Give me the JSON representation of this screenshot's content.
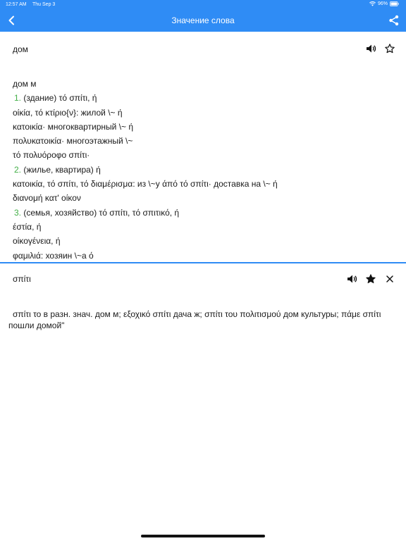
{
  "status_bar": {
    "time": "12:57 AM",
    "date": "Thu Sep 3",
    "battery": "96%"
  },
  "header": {
    "title": "Значение слова",
    "back_icon": "chevron-left-icon",
    "share_icon": "share-icon"
  },
  "colors": {
    "accent": "#2f8cf5",
    "number": "#43b047"
  },
  "panel1": {
    "word": "дом",
    "icons": [
      "speaker-icon",
      "star-outline-icon"
    ],
    "lines": [
      {
        "num": "",
        "text": "дом м"
      },
      {
        "num": "1.",
        "text": " (здание) τό σπίτι, ή"
      },
      {
        "num": "",
        "text": "οίκία, τό κτίριο{ν}: жилой \\~ ή"
      },
      {
        "num": "",
        "text": "κατοικία· многоквартирный \\~ ή"
      },
      {
        "num": "",
        "text": "πολυκατοικία· многоэтажный \\~"
      },
      {
        "num": "",
        "text": "τό πολυόροφο σπίτι·"
      },
      {
        "num": "2.",
        "text": " (жилье, квартира) ή"
      },
      {
        "num": "",
        "text": "κατοικία, τό σπίτι, τό διαμέρισμα: из \\~у άπό τό σπίτι· доставка на \\~ ή"
      },
      {
        "num": "",
        "text": "διανομή κατ' οίκον"
      },
      {
        "num": "3.",
        "text": " (семья, хозяйство) τό σπίτι, τό σπιτικό, ή"
      },
      {
        "num": "",
        "text": "έστία, ή"
      },
      {
        "num": "",
        "text": "οίκογένεια, ή"
      },
      {
        "num": "",
        "text": "φαμιλιά: хозяин \\~а ό"
      }
    ]
  },
  "panel2": {
    "word": "σπίτι",
    "icons": [
      "speaker-icon",
      "star-filled-icon",
      "close-icon"
    ],
    "definition": "σπίτι το в разн. знач. дом м; εξοχικό σπίτι дача ж; σπίτι του πολιτισμού дом культуры; πάμε σπίτι пошли домой\""
  }
}
